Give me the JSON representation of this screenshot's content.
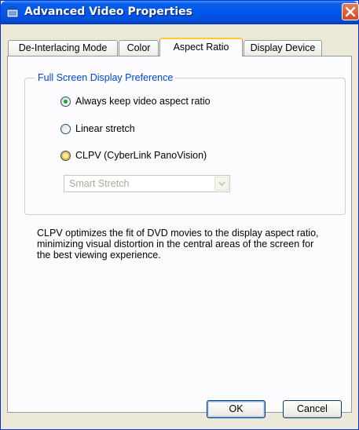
{
  "window": {
    "title": "Advanced Video Properties"
  },
  "tabs": [
    {
      "label": "De-Interlacing Mode",
      "active": false
    },
    {
      "label": "Color",
      "active": false
    },
    {
      "label": "Aspect Ratio",
      "active": true
    },
    {
      "label": "Display Device",
      "active": false
    }
  ],
  "group": {
    "label": "Full Screen Display Preference",
    "options": [
      {
        "label": "Always keep video aspect ratio",
        "selected": true
      },
      {
        "label": "Linear stretch",
        "selected": false
      },
      {
        "label": "CLPV (CyberLink PanoVision)",
        "selected": false
      }
    ],
    "clpv_mode": {
      "value": "Smart Stretch",
      "enabled": false
    }
  },
  "description": "CLPV optimizes the fit of DVD movies to the display aspect ratio, minimizing visual distortion in the central areas of the screen for the best viewing experience.",
  "buttons": {
    "ok": "OK",
    "cancel": "Cancel"
  },
  "colors": {
    "titlebar": "#0058ee",
    "accent": "#0046d5",
    "tab_highlight": "#ffc83c"
  }
}
